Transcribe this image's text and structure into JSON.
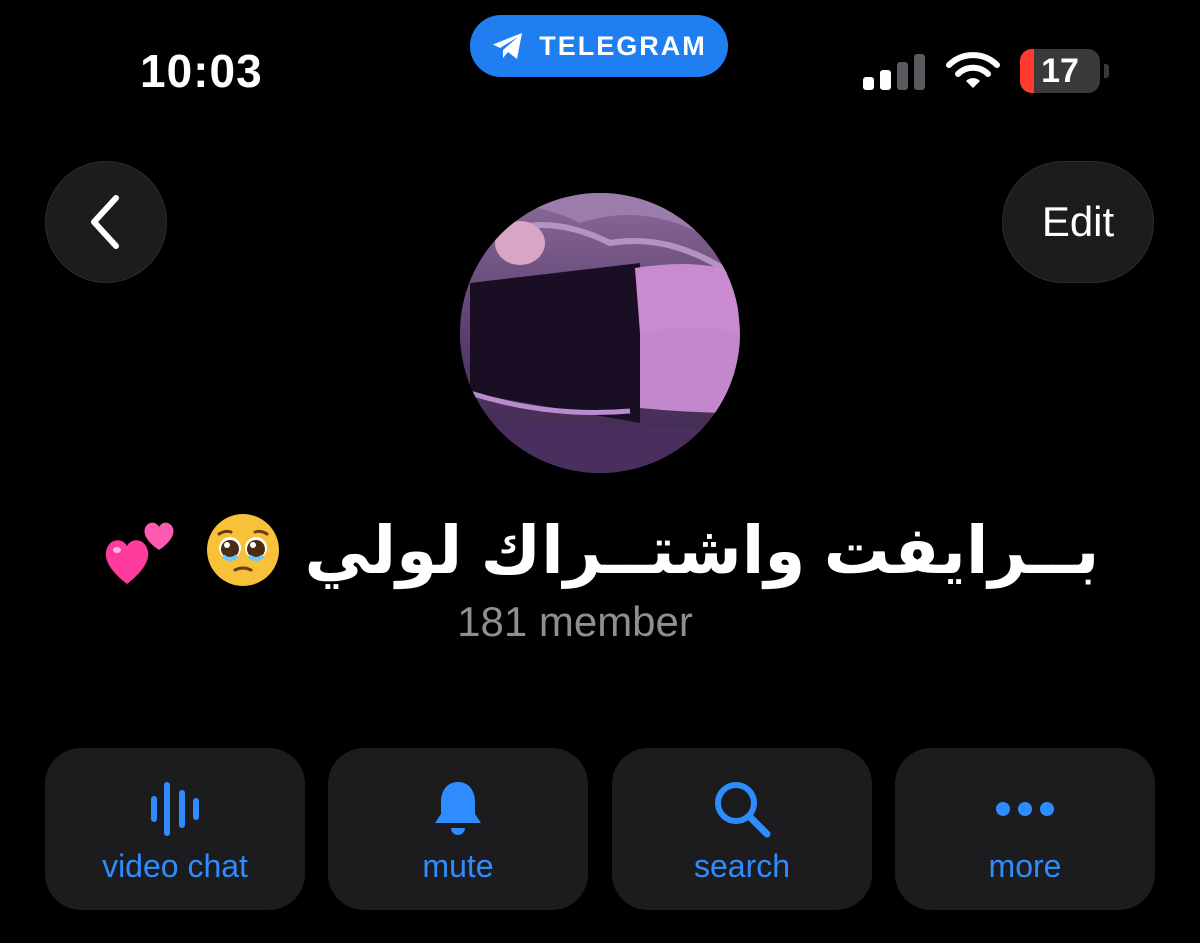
{
  "status_bar": {
    "time": "10:03",
    "app_pill_label": "TELEGRAM",
    "signal_bars_active": 2,
    "signal_bars_total": 4,
    "battery_level": "17",
    "battery_fraction": 0.17,
    "battery_color": "#ff3b30"
  },
  "nav": {
    "back_icon": "chevron-left-icon",
    "edit_label": "Edit"
  },
  "group": {
    "name": "بــرايفت واشتــراك لولي",
    "title_emojis": [
      "pleading-face-emoji",
      "two-hearts-emoji"
    ],
    "members": "181 member"
  },
  "actions": [
    {
      "label": "video chat",
      "icon": "voice-waveform-icon"
    },
    {
      "label": "mute",
      "icon": "bell-icon"
    },
    {
      "label": "search",
      "icon": "magnifier-icon"
    },
    {
      "label": "more",
      "icon": "ellipsis-icon"
    }
  ],
  "colors": {
    "background": "#000000",
    "accent": "#2f8cff",
    "pill": "#1f7ef0",
    "button_bg": "#1c1c1e",
    "secondary_text": "#8e8e93"
  }
}
